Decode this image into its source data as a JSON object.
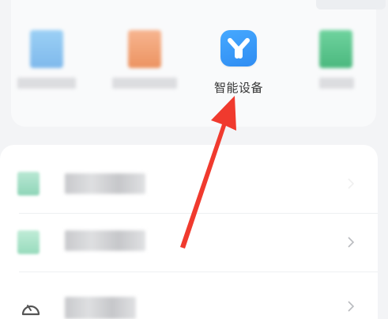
{
  "apps": {
    "featured": {
      "label": "智能设备",
      "icon": "smart-device-y-icon",
      "color": "#3d9cf8"
    },
    "blurred_colors": [
      "#8cc4ee",
      "#ef9f71",
      "#5cc48e"
    ]
  },
  "list": {
    "rows": [
      {
        "icon": "blurred-green-icon",
        "chevron": "chevron-right-icon",
        "color": "#9fdcc3"
      },
      {
        "icon": "blurred-green-icon",
        "chevron": "chevron-right-icon",
        "color": "#a9e0c6"
      },
      {
        "icon": "gauge-icon",
        "chevron": "chevron-right-icon",
        "color": "#555555"
      }
    ]
  },
  "annotation": {
    "arrow_color": "#f03a2e"
  }
}
